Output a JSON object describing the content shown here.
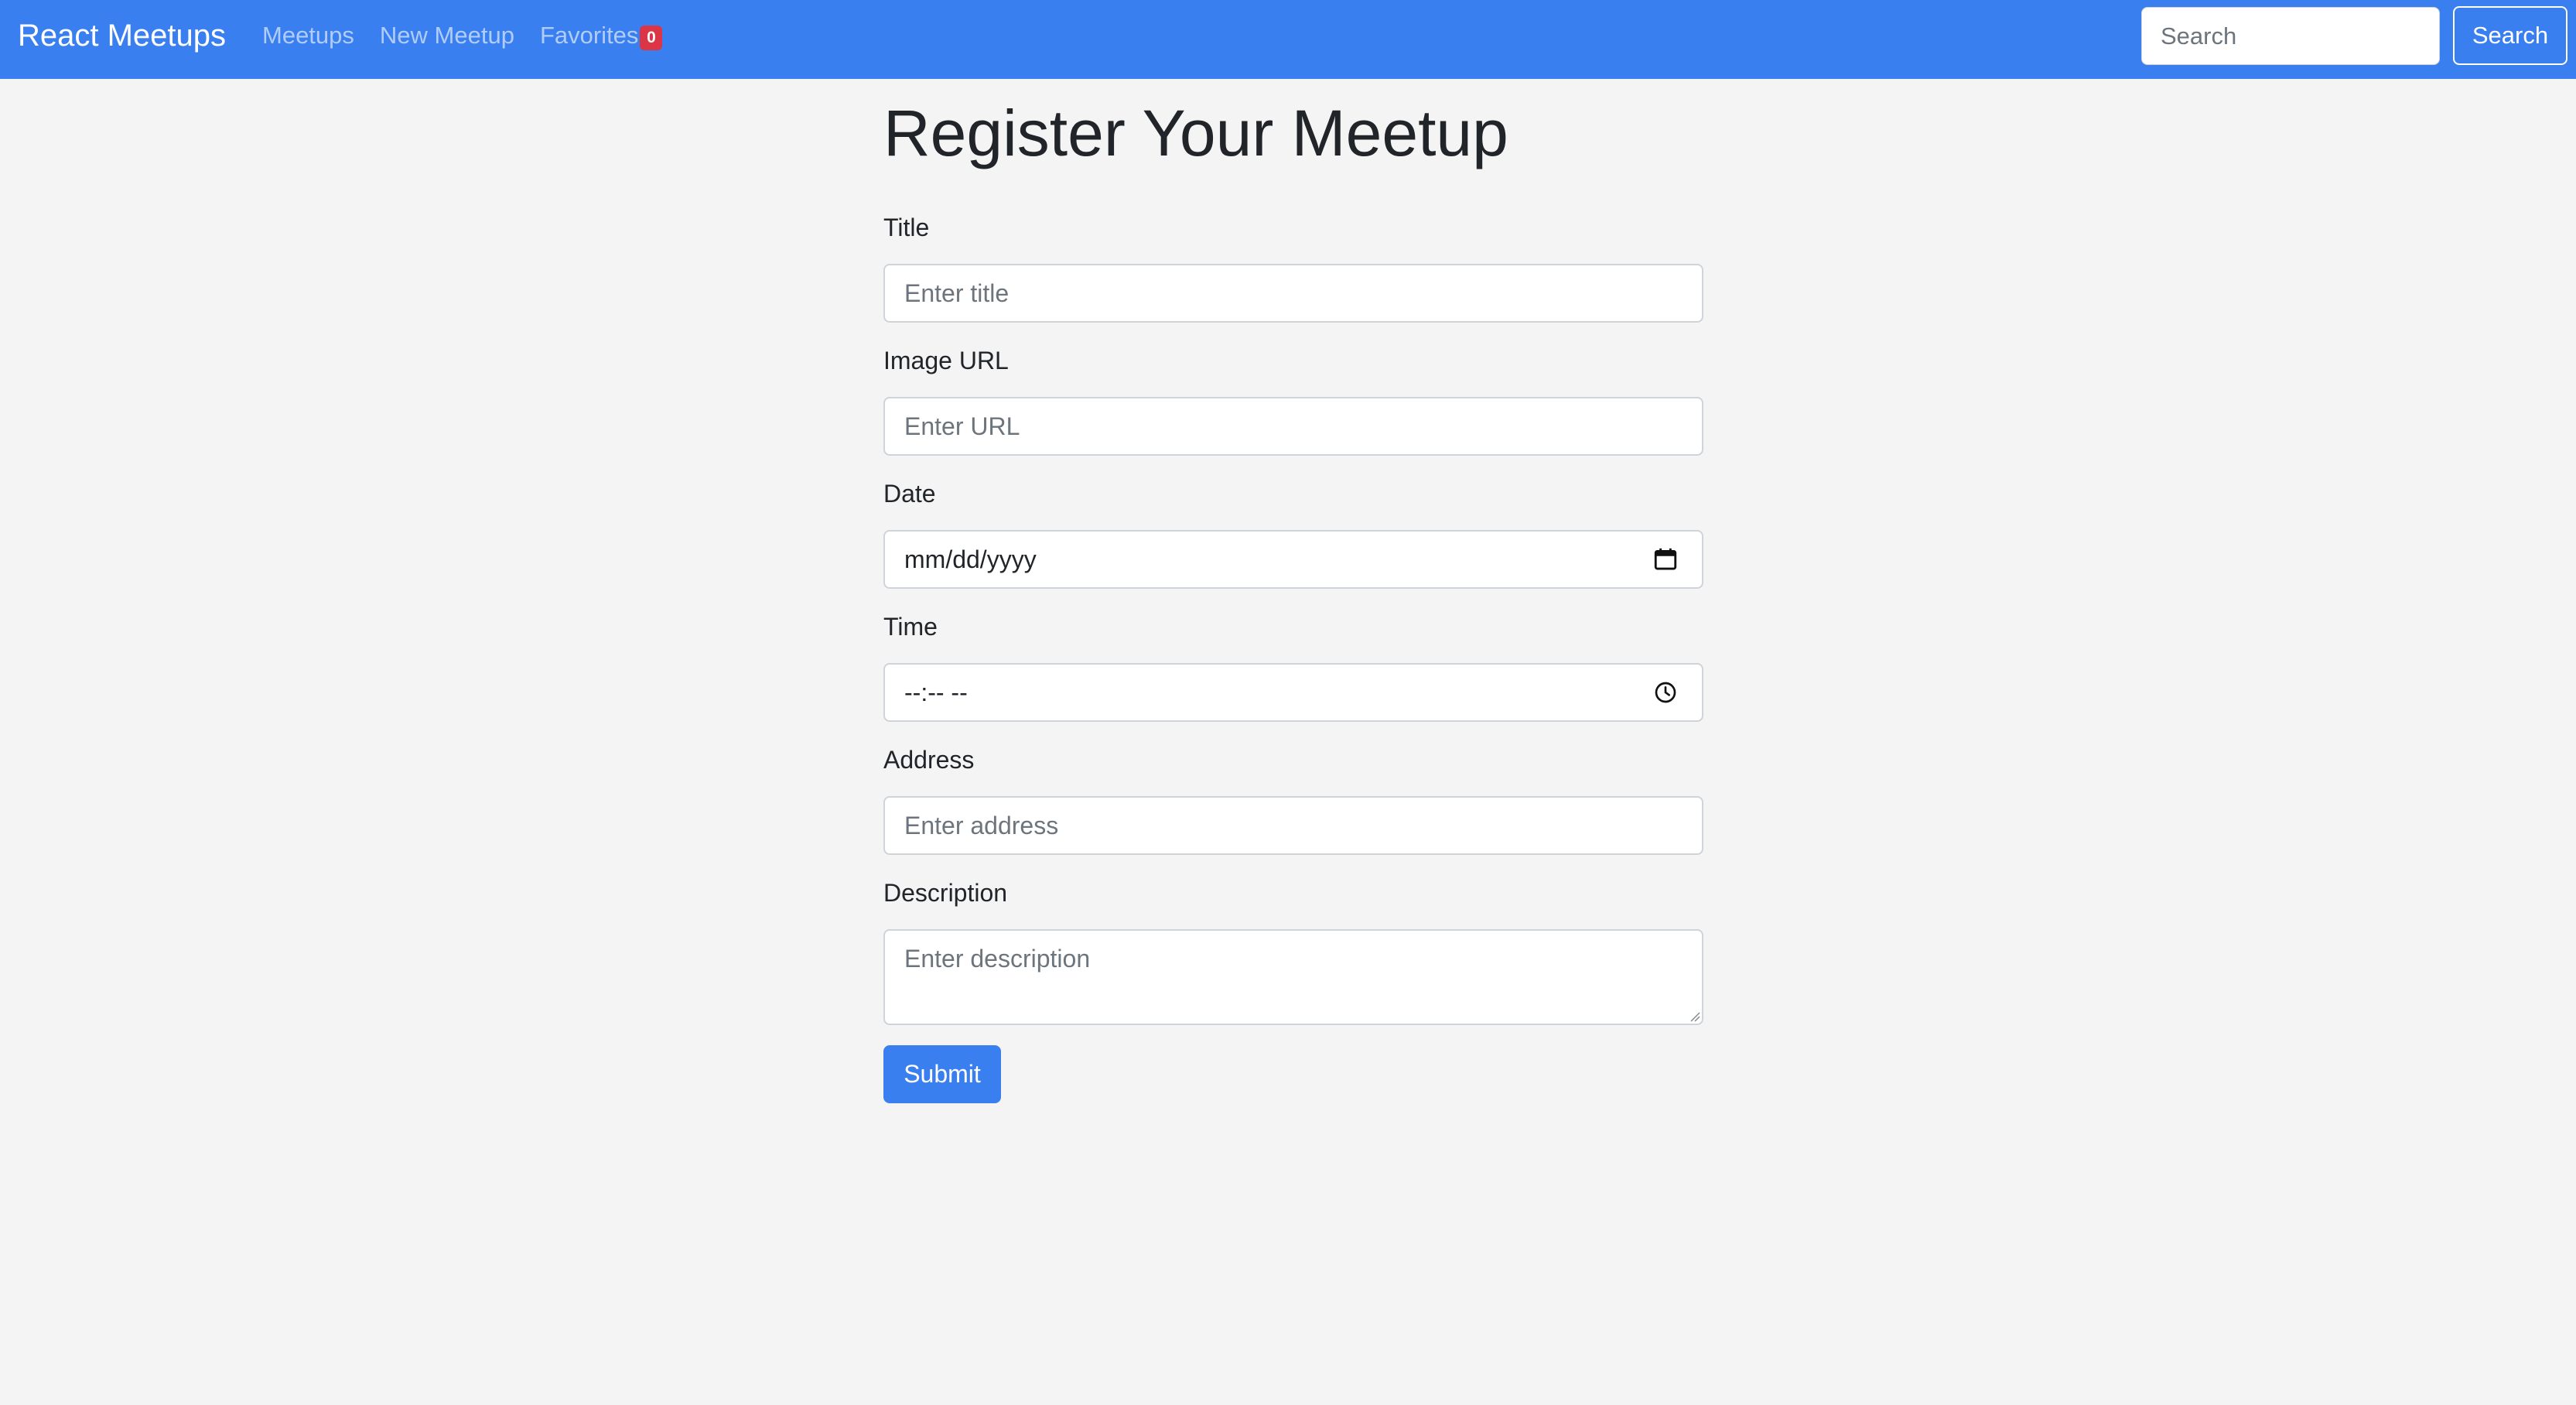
{
  "navbar": {
    "brand": "React Meetups",
    "links": [
      {
        "label": "Meetups"
      },
      {
        "label": "New Meetup"
      },
      {
        "label": "Favorites",
        "badge": "0"
      }
    ],
    "search": {
      "placeholder": "Search",
      "value": "",
      "button_label": "Search"
    },
    "background_color": "#3a7ff0",
    "badge_color": "#dc3545"
  },
  "form": {
    "title": "Register Your Meetup",
    "fields": {
      "title": {
        "label": "Title",
        "placeholder": "Enter title",
        "value": ""
      },
      "image_url": {
        "label": "Image URL",
        "placeholder": "Enter URL",
        "value": ""
      },
      "date": {
        "label": "Date",
        "display": "mm/dd/yyyy",
        "icon": "calendar-icon"
      },
      "time": {
        "label": "Time",
        "display": "--:-- --",
        "icon": "clock-icon"
      },
      "address": {
        "label": "Address",
        "placeholder": "Enter address",
        "value": ""
      },
      "description": {
        "label": "Description",
        "placeholder": "Enter description",
        "value": ""
      }
    },
    "submit_label": "Submit",
    "accent_color": "#3a7ff0"
  }
}
